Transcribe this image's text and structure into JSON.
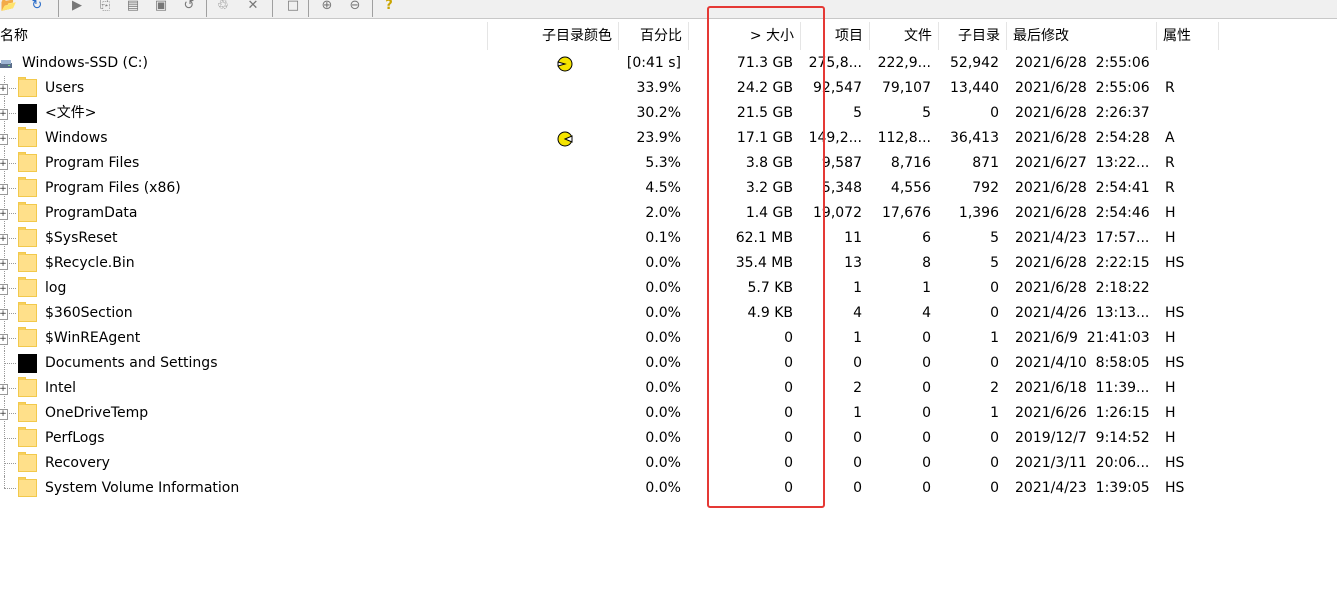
{
  "toolbar": {
    "icons": [
      "open-folder-icon",
      "refresh-icon",
      "play-icon",
      "copy-icon",
      "report-icon",
      "export-icon",
      "undo-icon",
      "clean-icon",
      "delete-icon",
      "new-icon",
      "zoom-in-icon",
      "zoom-out-icon",
      "help-icon"
    ]
  },
  "columns": {
    "name": "名称",
    "subdir_color": "子目录颜色",
    "percent": "百分比",
    "size": "> 大小",
    "items": "项目",
    "files": "文件",
    "subdirs": "子目录",
    "modified": "最后修改",
    "attributes": "属性"
  },
  "rows": [
    {
      "name": "Windows-SSD (C:)",
      "icon": "drive-icon",
      "color_pacman": "left",
      "percent": "[0:41 s]",
      "size": "71.3 GB",
      "items": "275,8...",
      "files": "222,9...",
      "subdirs": "52,942",
      "modified": "2021/6/28  2:55:06",
      "attr": ""
    },
    {
      "name": "Users",
      "icon": "folder-icon",
      "percent": "33.9%",
      "size": "24.2 GB",
      "items": "92,547",
      "files": "79,107",
      "subdirs": "13,440",
      "modified": "2021/6/28  2:55:06",
      "attr": "R"
    },
    {
      "name": "<文件>",
      "icon": "files-icon",
      "percent": "30.2%",
      "size": "21.5 GB",
      "items": "5",
      "files": "5",
      "subdirs": "0",
      "modified": "2021/6/28  2:26:37",
      "attr": ""
    },
    {
      "name": "Windows",
      "icon": "folder-icon",
      "color_pacman": "right",
      "percent": "23.9%",
      "size": "17.1 GB",
      "items": "149,2...",
      "files": "112,8...",
      "subdirs": "36,413",
      "modified": "2021/6/28  2:54:28",
      "attr": "A"
    },
    {
      "name": "Program Files",
      "icon": "folder-icon",
      "percent": "5.3%",
      "size": "3.8 GB",
      "items": "9,587",
      "files": "8,716",
      "subdirs": "871",
      "modified": "2021/6/27  13:22...",
      "attr": "R"
    },
    {
      "name": "Program Files (x86)",
      "icon": "folder-icon",
      "percent": "4.5%",
      "size": "3.2 GB",
      "items": "5,348",
      "files": "4,556",
      "subdirs": "792",
      "modified": "2021/6/28  2:54:41",
      "attr": "R"
    },
    {
      "name": "ProgramData",
      "icon": "folder-icon",
      "percent": "2.0%",
      "size": "1.4 GB",
      "items": "19,072",
      "files": "17,676",
      "subdirs": "1,396",
      "modified": "2021/6/28  2:54:46",
      "attr": "H"
    },
    {
      "name": "$SysReset",
      "icon": "folder-icon",
      "percent": "0.1%",
      "size": "62.1 MB",
      "items": "11",
      "files": "6",
      "subdirs": "5",
      "modified": "2021/4/23  17:57...",
      "attr": "H"
    },
    {
      "name": "$Recycle.Bin",
      "icon": "folder-icon",
      "percent": "0.0%",
      "size": "35.4 MB",
      "items": "13",
      "files": "8",
      "subdirs": "5",
      "modified": "2021/6/28  2:22:15",
      "attr": "HS"
    },
    {
      "name": "log",
      "icon": "folder-icon",
      "percent": "0.0%",
      "size": "5.7 KB",
      "items": "1",
      "files": "1",
      "subdirs": "0",
      "modified": "2021/6/28  2:18:22",
      "attr": ""
    },
    {
      "name": "$360Section",
      "icon": "folder-icon",
      "percent": "0.0%",
      "size": "4.9 KB",
      "items": "4",
      "files": "4",
      "subdirs": "0",
      "modified": "2021/4/26  13:13...",
      "attr": "HS"
    },
    {
      "name": "$WinREAgent",
      "icon": "folder-icon",
      "percent": "0.0%",
      "size": "0",
      "items": "1",
      "files": "0",
      "subdirs": "1",
      "modified": "2021/6/9  21:41:03",
      "attr": "H"
    },
    {
      "name": "Documents and Settings",
      "icon": "junction-icon",
      "percent": "0.0%",
      "size": "0",
      "items": "0",
      "files": "0",
      "subdirs": "0",
      "modified": "2021/4/10  8:58:05",
      "attr": "HS"
    },
    {
      "name": "Intel",
      "icon": "folder-icon",
      "percent": "0.0%",
      "size": "0",
      "items": "2",
      "files": "0",
      "subdirs": "2",
      "modified": "2021/6/18  11:39...",
      "attr": "H"
    },
    {
      "name": "OneDriveTemp",
      "icon": "folder-icon",
      "percent": "0.0%",
      "size": "0",
      "items": "1",
      "files": "0",
      "subdirs": "1",
      "modified": "2021/6/26  1:26:15",
      "attr": "H"
    },
    {
      "name": "PerfLogs",
      "icon": "folder-icon",
      "percent": "0.0%",
      "size": "0",
      "items": "0",
      "files": "0",
      "subdirs": "0",
      "modified": "2019/12/7  9:14:52",
      "attr": "H"
    },
    {
      "name": "Recovery",
      "icon": "folder-icon",
      "percent": "0.0%",
      "size": "0",
      "items": "0",
      "files": "0",
      "subdirs": "0",
      "modified": "2021/3/11  20:06...",
      "attr": "HS"
    },
    {
      "name": "System Volume Information",
      "icon": "folder-icon",
      "percent": "0.0%",
      "size": "0",
      "items": "0",
      "files": "0",
      "subdirs": "0",
      "modified": "2021/4/23  1:39:05",
      "attr": "HS"
    }
  ],
  "colors": {
    "highlight": "#e53935",
    "folder": "#ffe08a",
    "pacman": "#f5e400"
  }
}
